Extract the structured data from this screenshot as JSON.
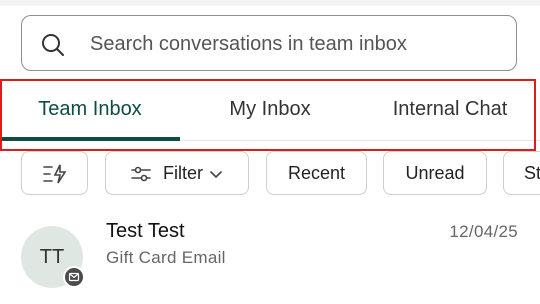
{
  "search": {
    "placeholder": "Search conversations in team inbox",
    "icon": "search-icon"
  },
  "tabs": [
    {
      "label": "Team Inbox",
      "active": true
    },
    {
      "label": "My Inbox",
      "active": false
    },
    {
      "label": "Internal Chat",
      "active": false
    }
  ],
  "filters": {
    "quick_icon": "sort-flash-icon",
    "filter_label": "Filter",
    "chips": [
      "Recent",
      "Unread",
      "St"
    ]
  },
  "conversations": [
    {
      "initials": "TT",
      "name": "Test Test",
      "preview": "Gift Card Email",
      "date": "12/04/25",
      "channel_icon": "email-icon"
    }
  ],
  "colors": {
    "accent": "#0f4c44",
    "highlight_box": "#e01b1b",
    "avatar_bg": "#dfe7e2"
  }
}
